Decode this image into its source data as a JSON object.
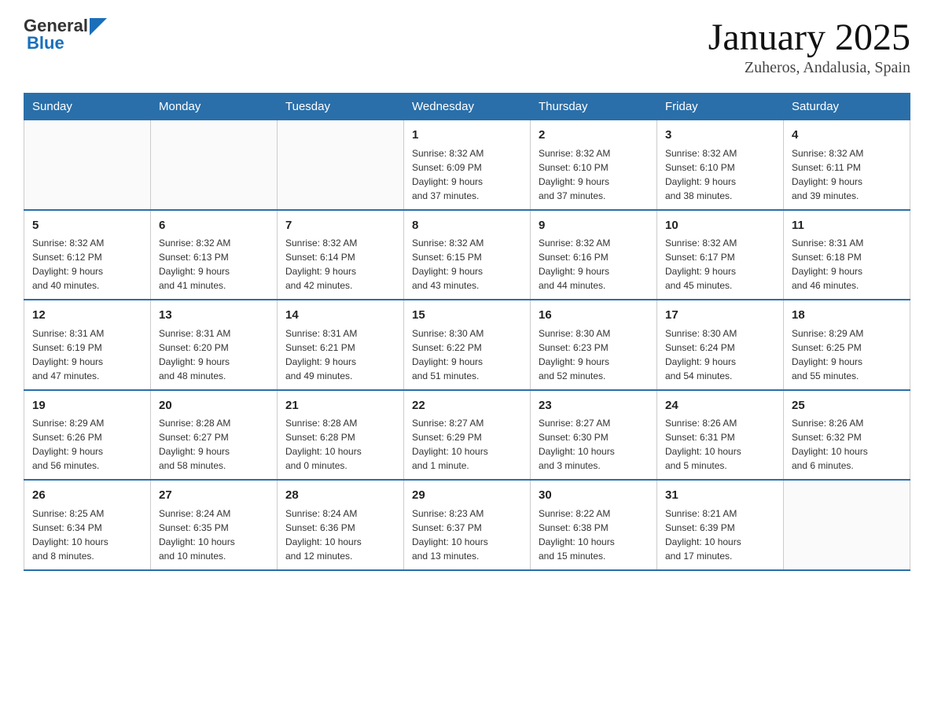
{
  "header": {
    "title": "January 2025",
    "location": "Zuheros, Andalusia, Spain",
    "logo_general": "General",
    "logo_blue": "Blue"
  },
  "columns": [
    "Sunday",
    "Monday",
    "Tuesday",
    "Wednesday",
    "Thursday",
    "Friday",
    "Saturday"
  ],
  "weeks": [
    [
      {
        "day": "",
        "info": ""
      },
      {
        "day": "",
        "info": ""
      },
      {
        "day": "",
        "info": ""
      },
      {
        "day": "1",
        "info": "Sunrise: 8:32 AM\nSunset: 6:09 PM\nDaylight: 9 hours\nand 37 minutes."
      },
      {
        "day": "2",
        "info": "Sunrise: 8:32 AM\nSunset: 6:10 PM\nDaylight: 9 hours\nand 37 minutes."
      },
      {
        "day": "3",
        "info": "Sunrise: 8:32 AM\nSunset: 6:10 PM\nDaylight: 9 hours\nand 38 minutes."
      },
      {
        "day": "4",
        "info": "Sunrise: 8:32 AM\nSunset: 6:11 PM\nDaylight: 9 hours\nand 39 minutes."
      }
    ],
    [
      {
        "day": "5",
        "info": "Sunrise: 8:32 AM\nSunset: 6:12 PM\nDaylight: 9 hours\nand 40 minutes."
      },
      {
        "day": "6",
        "info": "Sunrise: 8:32 AM\nSunset: 6:13 PM\nDaylight: 9 hours\nand 41 minutes."
      },
      {
        "day": "7",
        "info": "Sunrise: 8:32 AM\nSunset: 6:14 PM\nDaylight: 9 hours\nand 42 minutes."
      },
      {
        "day": "8",
        "info": "Sunrise: 8:32 AM\nSunset: 6:15 PM\nDaylight: 9 hours\nand 43 minutes."
      },
      {
        "day": "9",
        "info": "Sunrise: 8:32 AM\nSunset: 6:16 PM\nDaylight: 9 hours\nand 44 minutes."
      },
      {
        "day": "10",
        "info": "Sunrise: 8:32 AM\nSunset: 6:17 PM\nDaylight: 9 hours\nand 45 minutes."
      },
      {
        "day": "11",
        "info": "Sunrise: 8:31 AM\nSunset: 6:18 PM\nDaylight: 9 hours\nand 46 minutes."
      }
    ],
    [
      {
        "day": "12",
        "info": "Sunrise: 8:31 AM\nSunset: 6:19 PM\nDaylight: 9 hours\nand 47 minutes."
      },
      {
        "day": "13",
        "info": "Sunrise: 8:31 AM\nSunset: 6:20 PM\nDaylight: 9 hours\nand 48 minutes."
      },
      {
        "day": "14",
        "info": "Sunrise: 8:31 AM\nSunset: 6:21 PM\nDaylight: 9 hours\nand 49 minutes."
      },
      {
        "day": "15",
        "info": "Sunrise: 8:30 AM\nSunset: 6:22 PM\nDaylight: 9 hours\nand 51 minutes."
      },
      {
        "day": "16",
        "info": "Sunrise: 8:30 AM\nSunset: 6:23 PM\nDaylight: 9 hours\nand 52 minutes."
      },
      {
        "day": "17",
        "info": "Sunrise: 8:30 AM\nSunset: 6:24 PM\nDaylight: 9 hours\nand 54 minutes."
      },
      {
        "day": "18",
        "info": "Sunrise: 8:29 AM\nSunset: 6:25 PM\nDaylight: 9 hours\nand 55 minutes."
      }
    ],
    [
      {
        "day": "19",
        "info": "Sunrise: 8:29 AM\nSunset: 6:26 PM\nDaylight: 9 hours\nand 56 minutes."
      },
      {
        "day": "20",
        "info": "Sunrise: 8:28 AM\nSunset: 6:27 PM\nDaylight: 9 hours\nand 58 minutes."
      },
      {
        "day": "21",
        "info": "Sunrise: 8:28 AM\nSunset: 6:28 PM\nDaylight: 10 hours\nand 0 minutes."
      },
      {
        "day": "22",
        "info": "Sunrise: 8:27 AM\nSunset: 6:29 PM\nDaylight: 10 hours\nand 1 minute."
      },
      {
        "day": "23",
        "info": "Sunrise: 8:27 AM\nSunset: 6:30 PM\nDaylight: 10 hours\nand 3 minutes."
      },
      {
        "day": "24",
        "info": "Sunrise: 8:26 AM\nSunset: 6:31 PM\nDaylight: 10 hours\nand 5 minutes."
      },
      {
        "day": "25",
        "info": "Sunrise: 8:26 AM\nSunset: 6:32 PM\nDaylight: 10 hours\nand 6 minutes."
      }
    ],
    [
      {
        "day": "26",
        "info": "Sunrise: 8:25 AM\nSunset: 6:34 PM\nDaylight: 10 hours\nand 8 minutes."
      },
      {
        "day": "27",
        "info": "Sunrise: 8:24 AM\nSunset: 6:35 PM\nDaylight: 10 hours\nand 10 minutes."
      },
      {
        "day": "28",
        "info": "Sunrise: 8:24 AM\nSunset: 6:36 PM\nDaylight: 10 hours\nand 12 minutes."
      },
      {
        "day": "29",
        "info": "Sunrise: 8:23 AM\nSunset: 6:37 PM\nDaylight: 10 hours\nand 13 minutes."
      },
      {
        "day": "30",
        "info": "Sunrise: 8:22 AM\nSunset: 6:38 PM\nDaylight: 10 hours\nand 15 minutes."
      },
      {
        "day": "31",
        "info": "Sunrise: 8:21 AM\nSunset: 6:39 PM\nDaylight: 10 hours\nand 17 minutes."
      },
      {
        "day": "",
        "info": ""
      }
    ]
  ]
}
